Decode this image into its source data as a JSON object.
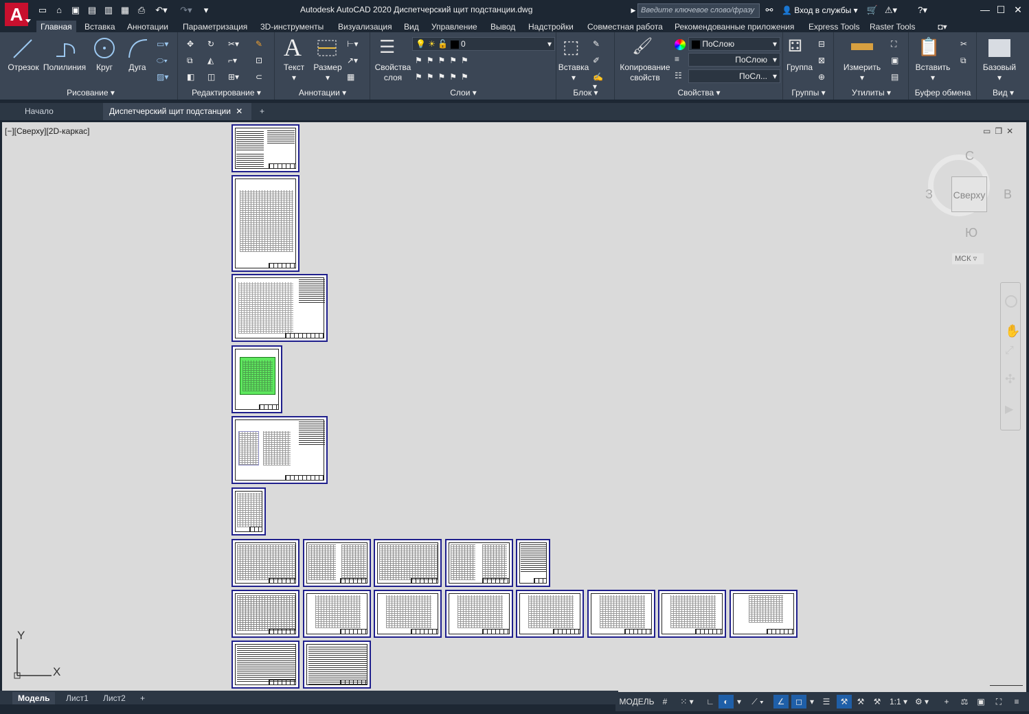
{
  "titlebar": {
    "title": "Autodesk AutoCAD 2020  Диспетчерский щит подстанции.dwg",
    "search_placeholder": "Введите ключевое слово/фразу",
    "signin": "Вход в службы"
  },
  "app_letter": "A",
  "ribbon_tabs": [
    "Главная",
    "Вставка",
    "Аннотации",
    "Параметризация",
    "3D-инструменты",
    "Визуализация",
    "Вид",
    "Управление",
    "Вывод",
    "Надстройки",
    "Совместная работа",
    "Рекомендованные приложения",
    "Express Tools",
    "Raster Tools"
  ],
  "panels": {
    "draw": {
      "title": "Рисование",
      "line": "Отрезок",
      "polyline": "Полилиния",
      "circle": "Круг",
      "arc": "Дуга"
    },
    "modify": {
      "title": "Редактирование"
    },
    "annotate": {
      "title": "Аннотации",
      "text": "Текст",
      "dim": "Размер"
    },
    "layers": {
      "title": "Слои",
      "props_l1": "Свойства",
      "props_l2": "слоя",
      "current_layer": "0"
    },
    "block": {
      "title": "Блок",
      "insert": "Вставка"
    },
    "props": {
      "title": "Свойства",
      "match_l1": "Копирование",
      "match_l2": "свойств",
      "color": "ПоСлою",
      "linetype": "ПоСлою",
      "lineweight": "ПоСл..."
    },
    "groups": {
      "title": "Группы",
      "group": "Группа"
    },
    "utils": {
      "title": "Утилиты",
      "measure": "Измерить"
    },
    "clipboard": {
      "title": "Буфер обмена",
      "paste": "Вставить"
    },
    "view": {
      "title": "Вид",
      "base": "Базовый"
    }
  },
  "filetabs": {
    "start": "Начало",
    "active": "Диспетчерский щит подстанции",
    "add": "+"
  },
  "viewport": {
    "label": "[−][Сверху][2D-каркас]"
  },
  "viewcube": {
    "north": "С",
    "south": "Ю",
    "west": "З",
    "east": "В",
    "face": "Сверху",
    "ucs": "МСК"
  },
  "ucs": {
    "x": "X",
    "y": "Y"
  },
  "layout_tabs": [
    "Модель",
    "Лист1",
    "Лист2"
  ],
  "layout_add": "+",
  "status": {
    "model": "МОДЕЛЬ",
    "scale": "1:1"
  }
}
